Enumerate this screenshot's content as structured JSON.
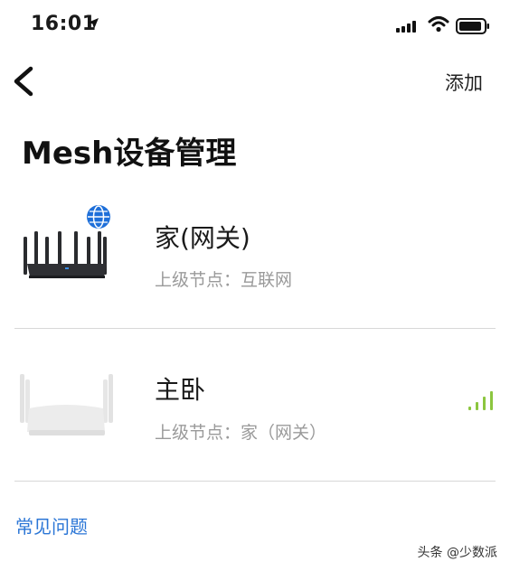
{
  "status_bar": {
    "time": "16:01",
    "icons": [
      "location-arrow-icon",
      "cellular-signal-icon",
      "wifi-icon",
      "battery-icon"
    ]
  },
  "nav": {
    "back_icon": "chevron-left-icon",
    "add_label": "添加"
  },
  "page": {
    "title": "Mesh设备管理"
  },
  "devices": [
    {
      "name": "家(网关)",
      "parent": "上级节点：互联网",
      "icon": "router-dark-icon",
      "badge_icon": "globe-icon",
      "badge_color": "#1e6fd9"
    },
    {
      "name": "主卧",
      "parent": "上级节点：家（网关）",
      "icon": "router-light-icon",
      "signal_icon": "signal-strength-icon",
      "signal_color": "#8cc63f"
    }
  ],
  "footer": {
    "faq_label": "常见问题",
    "link_color": "#2b76d6"
  },
  "watermark": {
    "text": "头条 @少数派"
  }
}
